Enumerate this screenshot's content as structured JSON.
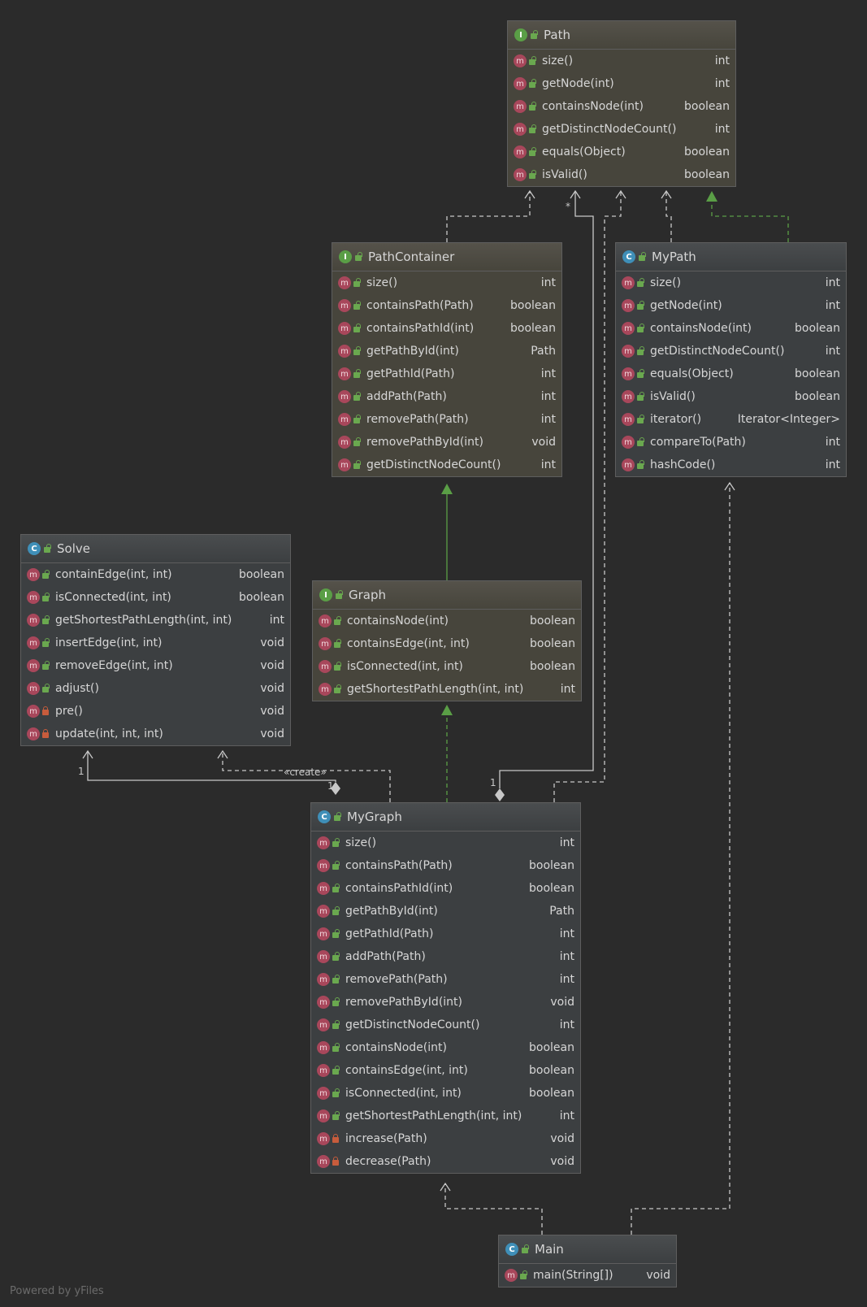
{
  "nodes": {
    "path": {
      "name": "Path",
      "kind": "I",
      "members": [
        {
          "name": "size()",
          "type": "int",
          "vis": "pub"
        },
        {
          "name": "getNode(int)",
          "type": "int",
          "vis": "pub"
        },
        {
          "name": "containsNode(int)",
          "type": "boolean",
          "vis": "pub"
        },
        {
          "name": "getDistinctNodeCount()",
          "type": "int",
          "vis": "pub"
        },
        {
          "name": "equals(Object)",
          "type": "boolean",
          "vis": "pub"
        },
        {
          "name": "isValid()",
          "type": "boolean",
          "vis": "pub"
        }
      ]
    },
    "pathcontainer": {
      "name": "PathContainer",
      "kind": "I",
      "members": [
        {
          "name": "size()",
          "type": "int",
          "vis": "pub"
        },
        {
          "name": "containsPath(Path)",
          "type": "boolean",
          "vis": "pub"
        },
        {
          "name": "containsPathId(int)",
          "type": "boolean",
          "vis": "pub"
        },
        {
          "name": "getPathById(int)",
          "type": "Path",
          "vis": "pub"
        },
        {
          "name": "getPathId(Path)",
          "type": "int",
          "vis": "pub"
        },
        {
          "name": "addPath(Path)",
          "type": "int",
          "vis": "pub"
        },
        {
          "name": "removePath(Path)",
          "type": "int",
          "vis": "pub"
        },
        {
          "name": "removePathById(int)",
          "type": "void",
          "vis": "pub"
        },
        {
          "name": "getDistinctNodeCount()",
          "type": "int",
          "vis": "pub"
        }
      ]
    },
    "mypath": {
      "name": "MyPath",
      "kind": "C",
      "members": [
        {
          "name": "size()",
          "type": "int",
          "vis": "pub"
        },
        {
          "name": "getNode(int)",
          "type": "int",
          "vis": "pub"
        },
        {
          "name": "containsNode(int)",
          "type": "boolean",
          "vis": "pub"
        },
        {
          "name": "getDistinctNodeCount()",
          "type": "int",
          "vis": "pub"
        },
        {
          "name": "equals(Object)",
          "type": "boolean",
          "vis": "pub"
        },
        {
          "name": "isValid()",
          "type": "boolean",
          "vis": "pub"
        },
        {
          "name": "iterator()",
          "type": "Iterator<Integer>",
          "vis": "pub"
        },
        {
          "name": "compareTo(Path)",
          "type": "int",
          "vis": "pub"
        },
        {
          "name": "hashCode()",
          "type": "int",
          "vis": "pub"
        }
      ]
    },
    "solve": {
      "name": "Solve",
      "kind": "C",
      "members": [
        {
          "name": "containEdge(int, int)",
          "type": "boolean",
          "vis": "pub"
        },
        {
          "name": "isConnected(int, int)",
          "type": "boolean",
          "vis": "pub"
        },
        {
          "name": "getShortestPathLength(int, int)",
          "type": "int",
          "vis": "pub"
        },
        {
          "name": "insertEdge(int, int)",
          "type": "void",
          "vis": "pub"
        },
        {
          "name": "removeEdge(int, int)",
          "type": "void",
          "vis": "pub"
        },
        {
          "name": "adjust()",
          "type": "void",
          "vis": "pub"
        },
        {
          "name": "pre()",
          "type": "void",
          "vis": "priv"
        },
        {
          "name": "update(int, int, int)",
          "type": "void",
          "vis": "priv"
        }
      ]
    },
    "graph": {
      "name": "Graph",
      "kind": "I",
      "members": [
        {
          "name": "containsNode(int)",
          "type": "boolean",
          "vis": "pub"
        },
        {
          "name": "containsEdge(int, int)",
          "type": "boolean",
          "vis": "pub"
        },
        {
          "name": "isConnected(int, int)",
          "type": "boolean",
          "vis": "pub"
        },
        {
          "name": "getShortestPathLength(int, int)",
          "type": "int",
          "vis": "pub"
        }
      ]
    },
    "mygraph": {
      "name": "MyGraph",
      "kind": "C",
      "members": [
        {
          "name": "size()",
          "type": "int",
          "vis": "pub"
        },
        {
          "name": "containsPath(Path)",
          "type": "boolean",
          "vis": "pub"
        },
        {
          "name": "containsPathId(int)",
          "type": "boolean",
          "vis": "pub"
        },
        {
          "name": "getPathById(int)",
          "type": "Path",
          "vis": "pub"
        },
        {
          "name": "getPathId(Path)",
          "type": "int",
          "vis": "pub"
        },
        {
          "name": "addPath(Path)",
          "type": "int",
          "vis": "pub"
        },
        {
          "name": "removePath(Path)",
          "type": "int",
          "vis": "pub"
        },
        {
          "name": "removePathById(int)",
          "type": "void",
          "vis": "pub"
        },
        {
          "name": "getDistinctNodeCount()",
          "type": "int",
          "vis": "pub"
        },
        {
          "name": "containsNode(int)",
          "type": "boolean",
          "vis": "pub"
        },
        {
          "name": "containsEdge(int, int)",
          "type": "boolean",
          "vis": "pub"
        },
        {
          "name": "isConnected(int, int)",
          "type": "boolean",
          "vis": "pub"
        },
        {
          "name": "getShortestPathLength(int, int)",
          "type": "int",
          "vis": "pub"
        },
        {
          "name": "increase(Path)",
          "type": "void",
          "vis": "priv"
        },
        {
          "name": "decrease(Path)",
          "type": "void",
          "vis": "priv"
        }
      ]
    },
    "main": {
      "name": "Main",
      "kind": "C",
      "members": [
        {
          "name": "main(String[])",
          "type": "void",
          "vis": "pub"
        }
      ]
    }
  },
  "labels": {
    "create": "«create»",
    "mult_path_star": "*",
    "mult_solve_one_a": "1",
    "mult_solve_one_b": "1",
    "mult_path_one": "1"
  },
  "footer": "Powered by yFiles",
  "colors": {
    "background": "#2b2b2b",
    "edge": "#c8c8c8",
    "implements": "#5a9e46",
    "interface_badge": "#5a9e46",
    "class_badge": "#3f8fb8",
    "method_badge": "#a8475b"
  }
}
